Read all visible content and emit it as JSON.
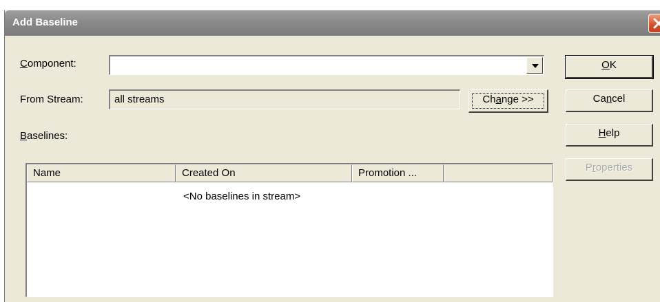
{
  "window": {
    "title": "Add Baseline"
  },
  "form": {
    "component_label": "Component:",
    "component_value": "",
    "from_stream_label": "From Stream:",
    "from_stream_value": "all streams",
    "change_button": "Change >>",
    "baselines_label": "Baselines:"
  },
  "baselines_table": {
    "columns": [
      "Name",
      "Created On",
      "Promotion ...",
      ""
    ],
    "empty_message": "<No baselines in stream>",
    "rows": []
  },
  "buttons": {
    "ok": "OK",
    "cancel": "Cancel",
    "help": "Help",
    "properties": "Properties"
  },
  "icons": {
    "close": "close-icon",
    "dropdown": "chevron-down-icon"
  }
}
